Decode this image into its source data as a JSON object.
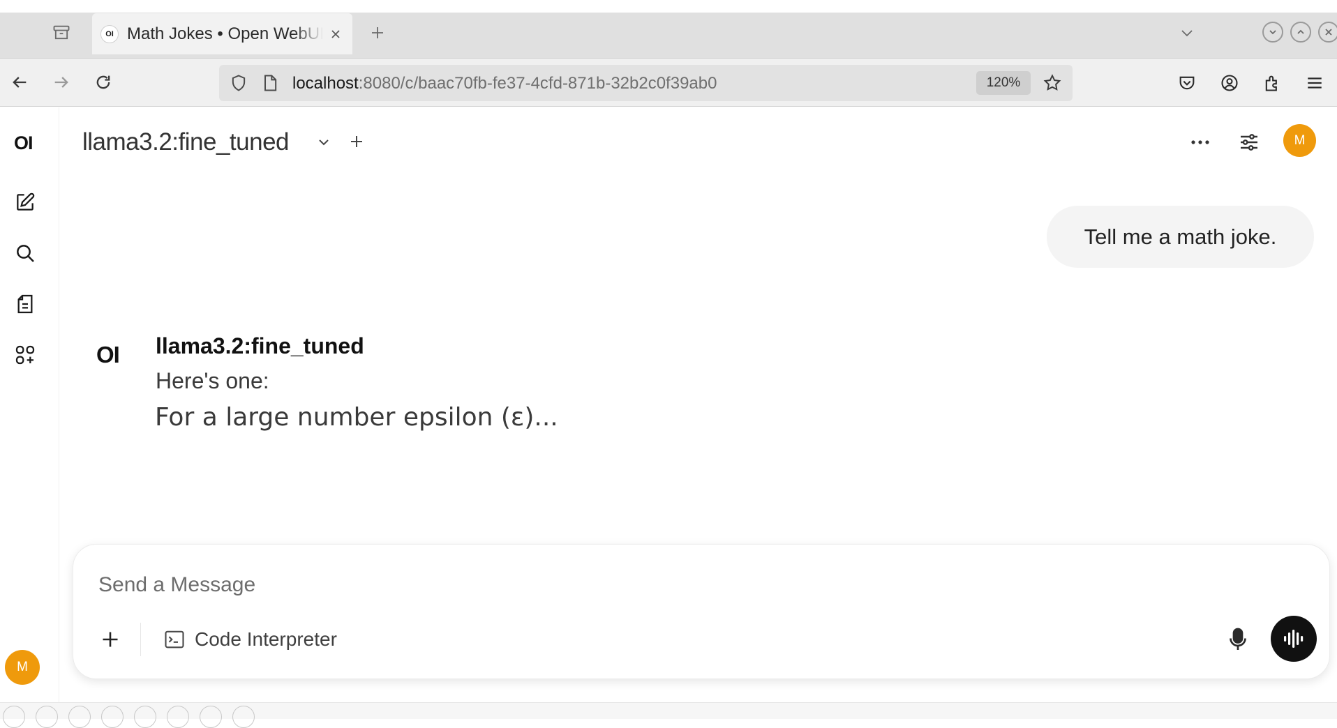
{
  "browser": {
    "tab_title": "Math Jokes • Open WebUI",
    "tab_favicon_text": "OI",
    "url_host": "localhost",
    "url_rest": ":8080/c/baac70fb-fe37-4cfd-871b-32b2c0f39ab0",
    "zoom": "120%",
    "icons": [
      "tab-overview-icon",
      "close-icon",
      "plus-icon",
      "chevron-down-icon",
      "back-icon",
      "forward-icon",
      "reload-icon",
      "shield-icon",
      "page-icon",
      "star-icon",
      "pocket-icon",
      "account-icon",
      "extensions-icon",
      "menu-icon"
    ]
  },
  "sidebar": {
    "logo_text": "OI",
    "user_initial": "M",
    "icons": [
      "new-chat-icon",
      "search-icon",
      "notes-icon",
      "workspace-icon"
    ]
  },
  "header": {
    "model_name": "llama3.2:fine_tuned",
    "user_initial": "M"
  },
  "chat": {
    "user_message": "Tell me a math joke.",
    "assistant": {
      "logo_text": "OI",
      "name": "llama3.2:fine_tuned",
      "line1": "Here's one:",
      "line2": "For a large number epsilon (ε)..."
    }
  },
  "composer": {
    "placeholder": "Send a Message",
    "code_interpreter_label": "Code Interpreter"
  },
  "colors": {
    "avatar": "#ef9a0c",
    "voice_button": "#111111",
    "tabbar": "#e0e0e0",
    "user_bubble": "#f4f4f4"
  }
}
